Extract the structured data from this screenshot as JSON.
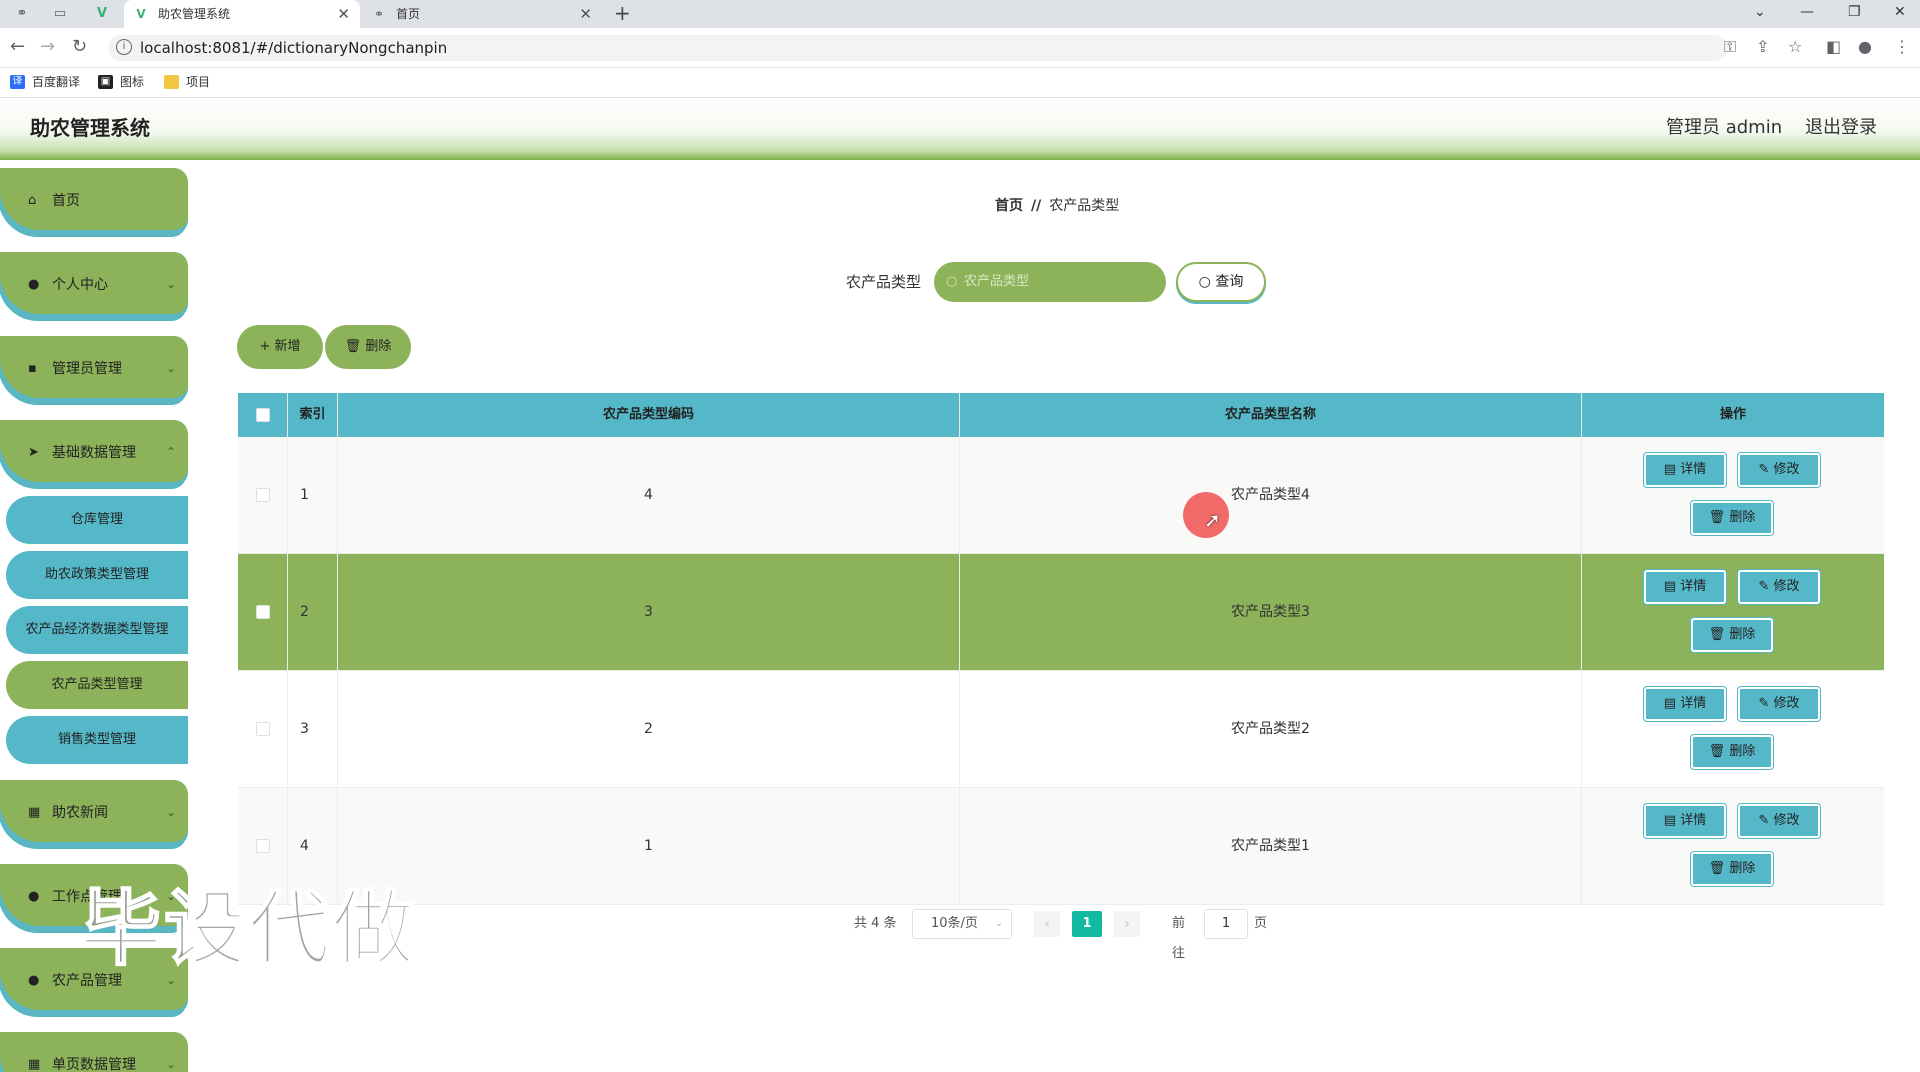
{
  "browser": {
    "tabs": [
      {
        "title": "助农管理系统",
        "active": true,
        "icon": "vue-logo-icon"
      },
      {
        "title": "首页",
        "active": false,
        "icon": "globe-icon"
      }
    ],
    "url": "localhost:8081/#/dictionaryNongchanpin",
    "bookmarks": [
      {
        "label": "百度翻译",
        "icon": "translate-icon",
        "color": "#2a6ef5"
      },
      {
        "label": "图标",
        "icon": "image-icon",
        "color": "#222222"
      },
      {
        "label": "项目",
        "icon": "folder-icon",
        "color": "#f2c744"
      }
    ]
  },
  "header": {
    "title": "助农管理系统",
    "user": "管理员 admin",
    "logout": "退出登录"
  },
  "sidebar": {
    "items": [
      {
        "label": "首页",
        "icon": "home-icon",
        "has_children": false
      },
      {
        "label": "个人中心",
        "icon": "user-icon",
        "has_children": true
      },
      {
        "label": "管理员管理",
        "icon": "admin-icon",
        "has_children": true
      },
      {
        "label": "基础数据管理",
        "icon": "send-icon",
        "has_children": true
      },
      {
        "label": "助农新闻",
        "icon": "grid-icon",
        "has_children": true
      },
      {
        "label": "工作点管理",
        "icon": "location-icon",
        "has_children": true
      },
      {
        "label": "农产品管理",
        "icon": "user-icon",
        "has_children": true
      },
      {
        "label": "单页数据管理",
        "icon": "grid-icon",
        "has_children": true
      }
    ],
    "sub_items": [
      {
        "label": "仓库管理",
        "active": false
      },
      {
        "label": "助农政策类型管理",
        "active": false
      },
      {
        "label": "农产品经济数据类型管理",
        "active": false
      },
      {
        "label": "农产品类型管理",
        "active": true
      },
      {
        "label": "销售类型管理",
        "active": false
      }
    ]
  },
  "breadcrumb": {
    "home": "首页",
    "separator": "//",
    "current": "农产品类型"
  },
  "search": {
    "label": "农产品类型",
    "placeholder": "农产品类型",
    "button": "查询"
  },
  "actions": {
    "add": "新增",
    "delete": "删除"
  },
  "table": {
    "columns": [
      "索引",
      "农产品类型编码",
      "农产品类型名称",
      "操作"
    ],
    "rows": [
      {
        "index": "1",
        "code": "4",
        "name": "农产品类型4"
      },
      {
        "index": "2",
        "code": "3",
        "name": "农产品类型3"
      },
      {
        "index": "3",
        "code": "2",
        "name": "农产品类型2"
      },
      {
        "index": "4",
        "code": "1",
        "name": "农产品类型1"
      }
    ],
    "row_actions": {
      "detail": "详情",
      "edit": "修改",
      "delete": "删除"
    }
  },
  "pagination": {
    "total": "共 4 条",
    "page_size": "10条/页",
    "current_page": "1",
    "goto_label": "前往",
    "goto_value": "1",
    "page_suffix": "页"
  },
  "watermark": "毕设代做",
  "colors": {
    "green": "#8cb35a",
    "teal": "#55b8c8",
    "pager_active": "#10b9a0"
  }
}
